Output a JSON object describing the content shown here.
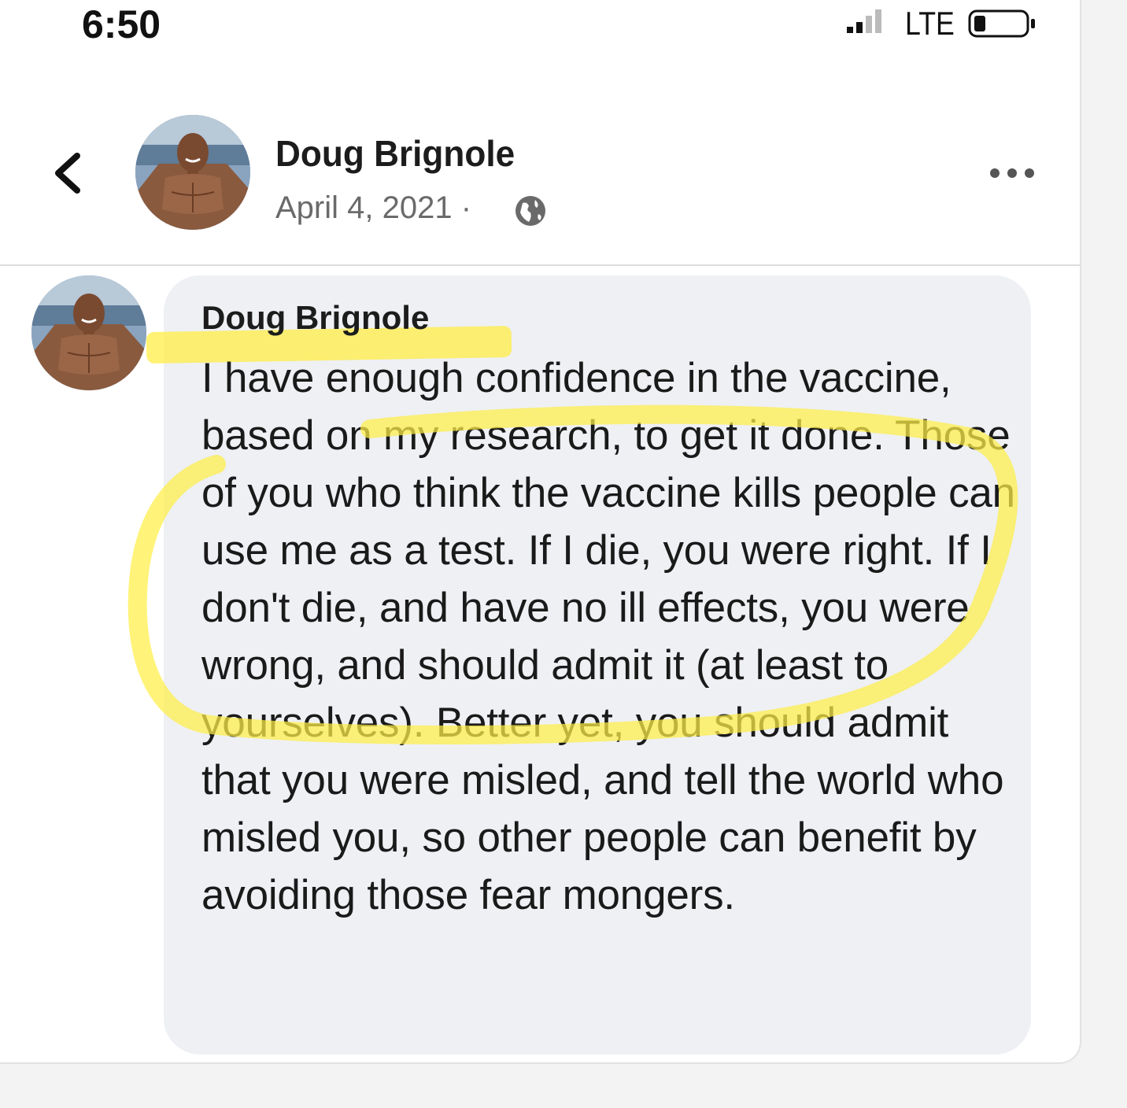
{
  "status_bar": {
    "time": "6:50",
    "network": "LTE"
  },
  "post_header": {
    "back_icon": "chevron-left-icon",
    "author_name": "Doug Brignole",
    "date": "April 4, 2021",
    "separator": "·",
    "privacy_icon": "globe-icon",
    "more_icon": "more-horizontal-icon"
  },
  "comment": {
    "author_name": "Doug Brignole",
    "text": "I have enough confidence in the vaccine, based on my research, to get it done. Those of you who think the vaccine kills people can use me as a test. If I die, you were right. If I don't die, and have no ill effects, you were wrong, and should admit it (at least to yourselves). Better yet, you should admit that you were misled, and tell the world who misled you, so other people can benefit by avoiding those fear mongers."
  },
  "colors": {
    "highlight": "#ffee46",
    "bubble": "#eef0f4",
    "name_text": "#1c1c1c",
    "date_text": "#6a6a6a"
  }
}
